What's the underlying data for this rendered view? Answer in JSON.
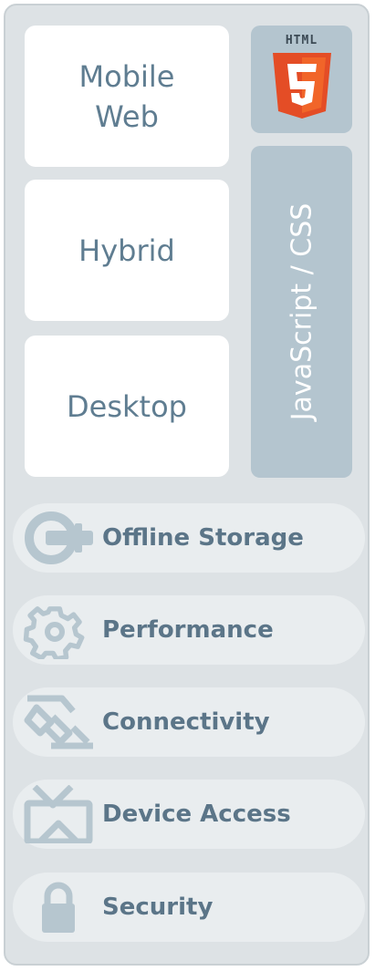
{
  "platforms": [
    {
      "label": "Mobile\nWeb"
    },
    {
      "label": "Hybrid"
    },
    {
      "label": "Desktop"
    }
  ],
  "html5": {
    "word": "HTML",
    "icon": "html5-logo-icon",
    "color": "#e44d26"
  },
  "tech": {
    "label": "JavaScript / CSS"
  },
  "features": [
    {
      "label": "Offline Storage",
      "icon": "offline-storage-icon"
    },
    {
      "label": "Performance",
      "icon": "performance-gear-icon"
    },
    {
      "label": "Connectivity",
      "icon": "connectivity-icon"
    },
    {
      "label": "Device Access",
      "icon": "device-access-icon"
    },
    {
      "label": "Security",
      "icon": "security-lock-icon"
    }
  ],
  "colors": {
    "background": "#dde2e5",
    "card": "#ffffff",
    "accent_box": "#b4c5cf",
    "pill": "#e9edef",
    "text": "#5f7d91",
    "icon": "#b6c6cf"
  }
}
